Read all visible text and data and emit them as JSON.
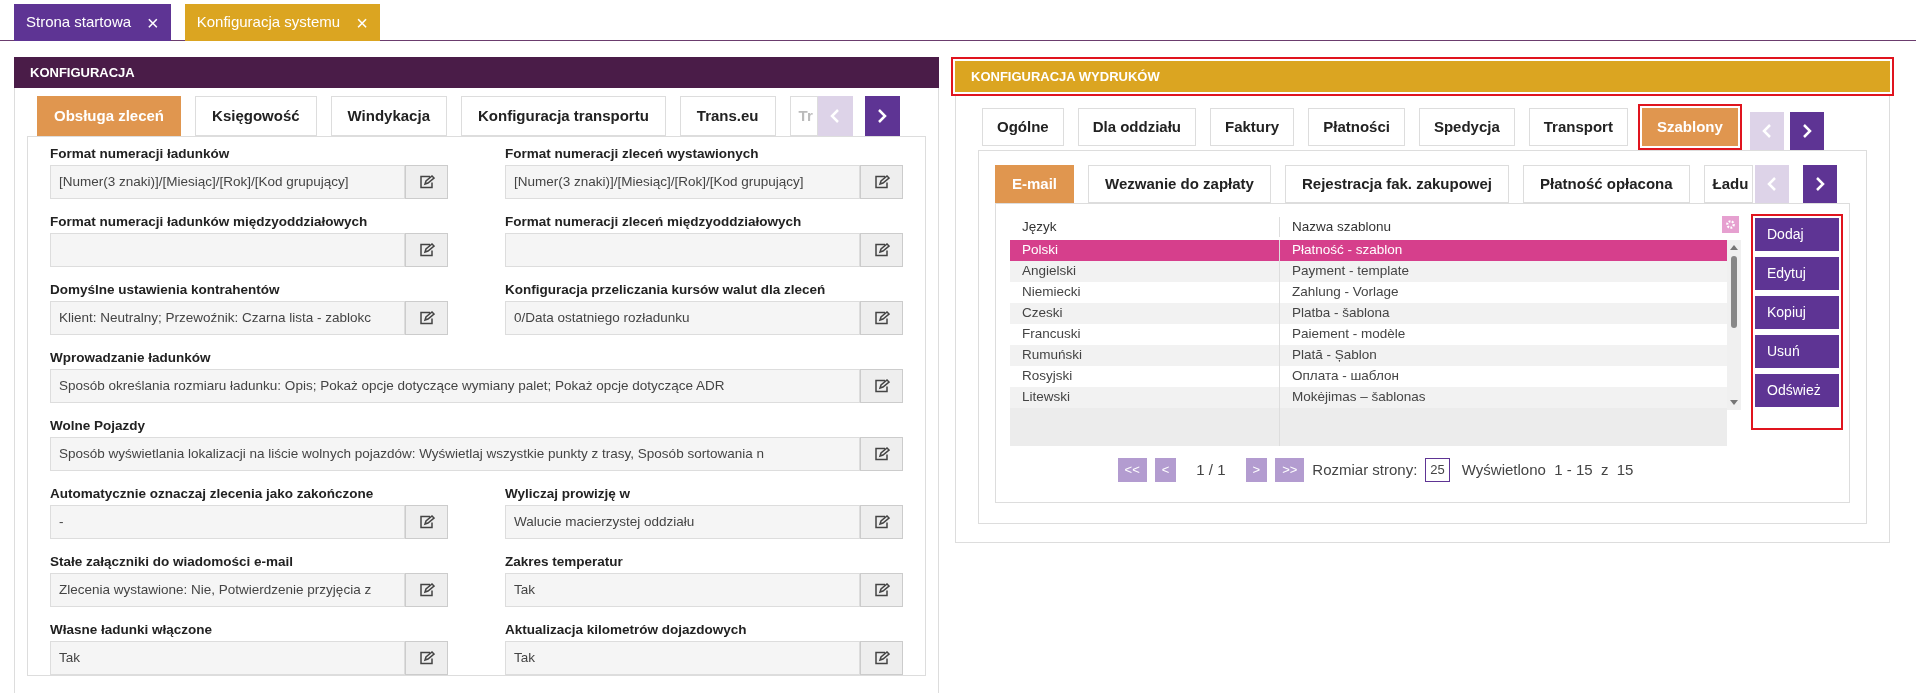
{
  "top_tabs": [
    {
      "label": "Strona startowa",
      "close": "×",
      "selected": false
    },
    {
      "label": "Konfiguracja systemu",
      "close": "×",
      "selected": true
    }
  ],
  "left_panel": {
    "title": "KONFIGURACJA",
    "tabs": [
      {
        "label": "Obsługa zleceń",
        "selected": true
      },
      {
        "label": "Księgowość",
        "selected": false
      },
      {
        "label": "Windykacja",
        "selected": false
      },
      {
        "label": "Konfiguracja transportu",
        "selected": false
      },
      {
        "label": "Trans.eu",
        "selected": false
      },
      {
        "label": "Tr",
        "selected": false
      }
    ],
    "rows": [
      [
        {
          "label": "Format numeracji ładunków",
          "value": "[Numer(3 znaki)]/[Miesiąc]/[Rok]/[Kod grupujący]"
        },
        {
          "label": "Format numeracji zleceń wystawionych",
          "value": "[Numer(3 znaki)]/[Miesiąc]/[Rok]/[Kod grupujący]"
        }
      ],
      [
        {
          "label": "Format numeracji ładunków międzyoddziałowych"
        },
        {
          "label": "Format numeracji zleceń międzyoddziałowych"
        }
      ],
      [
        {
          "label": "Domyślne ustawienia kontrahentów",
          "value": "Klient: Neutralny; Przewoźnik: Czarna lista - zablokc"
        },
        {
          "label": "Konfiguracja przeliczania kursów walut dla zleceń",
          "value": "0/Data ostatniego rozładunku"
        }
      ],
      [
        {
          "label": "Wprowadzanie ładunków",
          "value": "Sposób określania rozmiaru ładunku: Opis; Pokaż opcje dotyczące wymiany palet; Pokaż opcje dotyczące ADR"
        }
      ],
      [
        {
          "label": "Wolne Pojazdy",
          "value": "Sposób wyświetlania lokalizacji na liście wolnych pojazdów: Wyświetlaj wszystkie punkty z trasy, Sposób sortowania n"
        }
      ],
      [
        {
          "label": "Automatycznie oznaczaj zlecenia jako zakończone",
          "value": "-"
        },
        {
          "label": "Wyliczaj prowizję w",
          "value": "Walucie macierzystej oddziału"
        }
      ],
      [
        {
          "label": "Stałe załączniki do wiadomości e-mail",
          "value": "Zlecenia wystawione: Nie, Potwierdzenie przyjęcia z"
        },
        {
          "label": "Zakres temperatur",
          "value": "Tak"
        }
      ],
      [
        {
          "label": "Własne ładunki włączone",
          "value": "Tak"
        },
        {
          "label": "Aktualizacja kilometrów dojazdowych",
          "value": "Tak"
        }
      ]
    ]
  },
  "right_panel": {
    "title": "KONFIGURACJA WYDRUKÓW",
    "highlighted": true,
    "tabs": [
      {
        "label": "Ogólne",
        "selected": false,
        "highlighted": false
      },
      {
        "label": "Dla oddziału",
        "selected": false,
        "highlighted": false
      },
      {
        "label": "Faktury",
        "selected": false,
        "highlighted": false
      },
      {
        "label": "Płatności",
        "selected": false,
        "highlighted": false
      },
      {
        "label": "Spedycja",
        "selected": false,
        "highlighted": false
      },
      {
        "label": "Transport",
        "selected": false,
        "highlighted": false
      },
      {
        "label": "Szablony",
        "selected": true,
        "highlighted": true
      }
    ],
    "sub_tabs": [
      {
        "label": "E-mail",
        "selected": true
      },
      {
        "label": "Wezwanie do zapłaty",
        "selected": false
      },
      {
        "label": "Rejestracja fak. zakupowej",
        "selected": false
      },
      {
        "label": "Płatność opłacona",
        "selected": false
      },
      {
        "label": "Ładu",
        "selected": false
      }
    ],
    "table": {
      "columns": [
        "Język",
        "Nazwa szablonu"
      ],
      "rows": [
        {
          "cells": [
            "Polski",
            "Płatność - szablon"
          ],
          "selected": true
        },
        {
          "cells": [
            "Angielski",
            "Payment - template"
          ],
          "selected": false
        },
        {
          "cells": [
            "Niemiecki",
            "Zahlung - Vorlage"
          ],
          "selected": false
        },
        {
          "cells": [
            "Czeski",
            "Platba - šablona"
          ],
          "selected": false
        },
        {
          "cells": [
            "Francuski",
            "Paiement - modèle"
          ],
          "selected": false
        },
        {
          "cells": [
            "Rumuński",
            "Plată - Șablon"
          ],
          "selected": false
        },
        {
          "cells": [
            "Rosyjski",
            "Оплата - шаблон"
          ],
          "selected": false
        },
        {
          "cells": [
            "Litewski",
            "Mokėjimas – šablonas"
          ],
          "selected": false
        }
      ]
    },
    "pagination": {
      "buttons": [
        "<<",
        "<",
        ">",
        ">>"
      ],
      "page": "1 / 1",
      "page_size_label": "Rozmiar strony:",
      "page_size": "25",
      "shown": "Wyświetlono  1 - 15  z  15"
    },
    "actions": {
      "highlighted": true,
      "buttons": [
        "Dodaj",
        "Edytuj",
        "Kopiuj",
        "Usuń",
        "Odśwież"
      ]
    }
  }
}
